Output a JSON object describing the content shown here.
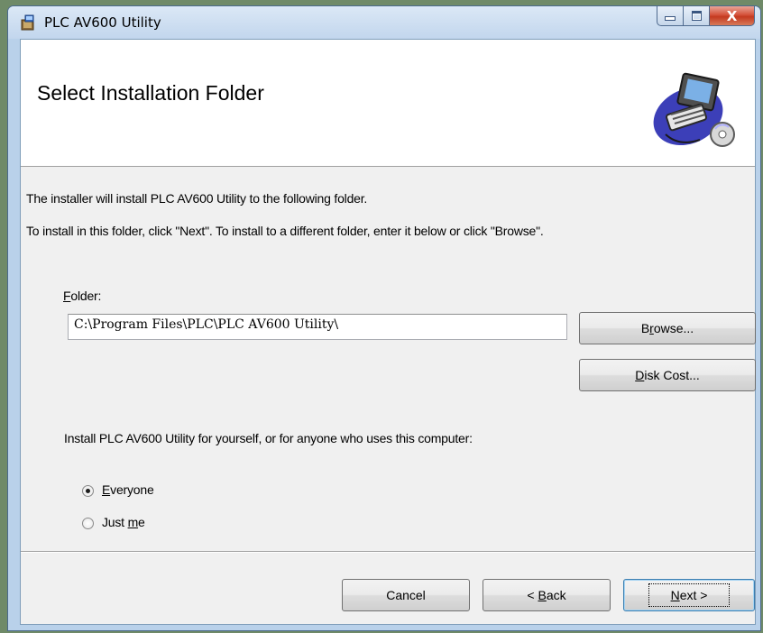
{
  "window": {
    "title": "PLC AV600 Utility",
    "close_glyph": "X"
  },
  "banner": {
    "title": "Select Installation Folder",
    "icon": "computer-with-cd-icon"
  },
  "intro": {
    "line1": "The installer will install PLC AV600 Utility to the following folder.",
    "line2": "To install in this folder, click \"Next\". To install to a different folder, enter it below or click \"Browse\"."
  },
  "folder": {
    "label_accel": "F",
    "label_rest": "older:",
    "value": "C:\\Program Files\\PLC\\PLC AV600 Utility\\"
  },
  "buttons": {
    "browse": {
      "pre": "B",
      "accel": "r",
      "post": "owse..."
    },
    "disk_cost": {
      "pre": "",
      "accel": "D",
      "post": "isk Cost..."
    },
    "cancel": "Cancel",
    "back": {
      "pre": "< ",
      "accel": "B",
      "post": "ack"
    },
    "next": {
      "pre": "",
      "accel": "N",
      "post": "ext >"
    }
  },
  "install_for": {
    "prompt": "Install PLC AV600 Utility for yourself, or for anyone who uses this computer:",
    "options": [
      {
        "pre": "",
        "accel": "E",
        "post": "veryone",
        "selected": true
      },
      {
        "pre": "Just ",
        "accel": "m",
        "post": "e",
        "selected": false
      }
    ]
  },
  "colors": {
    "titlebar": "#c2d6ed",
    "close_button": "#c43a20",
    "client_background": "#f0f0f0",
    "banner_background": "#ffffff"
  }
}
